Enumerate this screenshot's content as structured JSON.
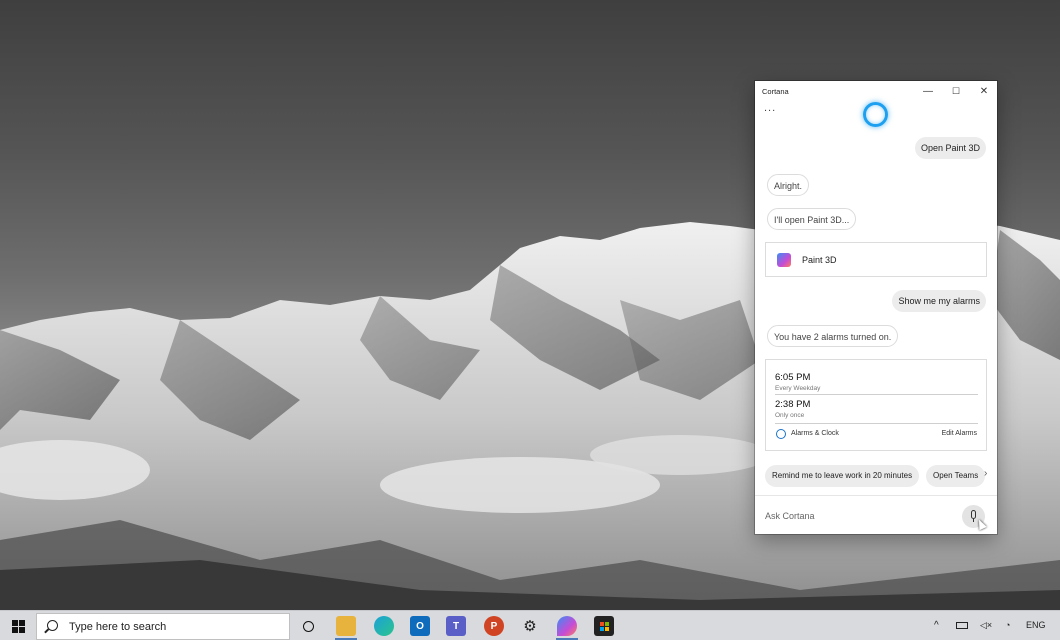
{
  "cortana": {
    "title": "Cortana",
    "more_label": "...",
    "minimize": "—",
    "maximize": "☐",
    "close": "✕",
    "messages": [
      {
        "from": "user",
        "text": "Open Paint 3D"
      },
      {
        "from": "cortana",
        "text": "Alright."
      },
      {
        "from": "cortana",
        "text": "I'll open Paint 3D..."
      },
      {
        "from": "user",
        "text": "Show me my alarms"
      },
      {
        "from": "cortana",
        "text": "You have 2 alarms turned on."
      }
    ],
    "app_card": {
      "label": "Paint 3D",
      "icon": "paint3d-icon"
    },
    "alarms": [
      {
        "time": "6:05 PM",
        "repeat": "Every Weekday"
      },
      {
        "time": "2:38 PM",
        "repeat": "Only once"
      }
    ],
    "alarms_app_label": "Alarms & Clock",
    "edit_alarms_label": "Edit Alarms",
    "suggestions": [
      "Remind me to leave work in 20 minutes",
      "Open Teams"
    ],
    "ask_placeholder": "Ask Cortana",
    "ring_color": "#1ea0f0"
  },
  "taskbar": {
    "search_placeholder": "Type here to search",
    "pinned_apps": [
      "task-view",
      "file-explorer",
      "edge",
      "outlook",
      "teams",
      "powerpoint",
      "settings",
      "paint3d",
      "store"
    ],
    "language": "ENG"
  }
}
